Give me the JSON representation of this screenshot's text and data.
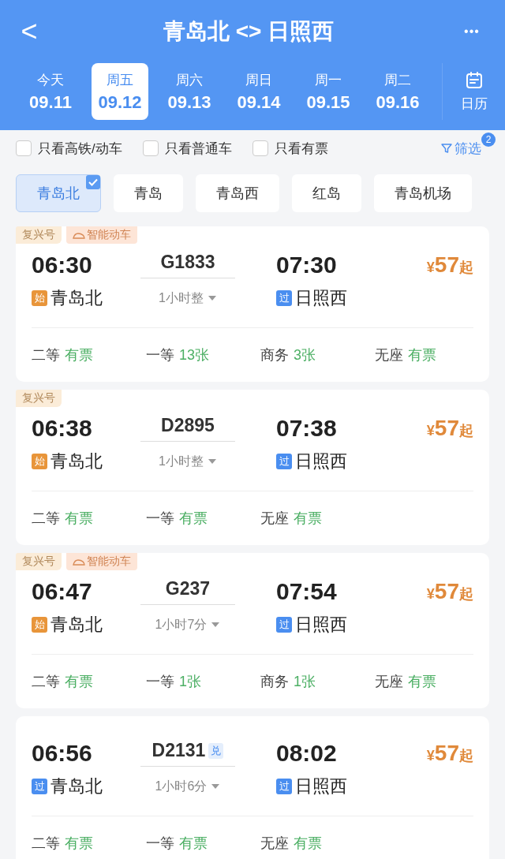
{
  "header": {
    "back": "<",
    "title": "青岛北 <> 日照西",
    "more": "•••"
  },
  "dates": [
    {
      "weekday": "今天",
      "date": "09.11",
      "selected": false
    },
    {
      "weekday": "周五",
      "date": "09.12",
      "selected": true
    },
    {
      "weekday": "周六",
      "date": "09.13",
      "selected": false
    },
    {
      "weekday": "周日",
      "date": "09.14",
      "selected": false
    },
    {
      "weekday": "周一",
      "date": "09.15",
      "selected": false
    },
    {
      "weekday": "周二",
      "date": "09.16",
      "selected": false
    }
  ],
  "calendar": {
    "label": "日历"
  },
  "filters": [
    {
      "label": "只看高铁/动车",
      "checked": false
    },
    {
      "label": "只看普通车",
      "checked": false
    },
    {
      "label": "只看有票",
      "checked": false
    }
  ],
  "filter_button": {
    "label": "筛选",
    "badge": "2"
  },
  "stations": [
    {
      "name": "青岛北",
      "selected": true
    },
    {
      "name": "青岛",
      "selected": false
    },
    {
      "name": "青岛西",
      "selected": false
    },
    {
      "name": "红岛",
      "selected": false
    },
    {
      "name": "青岛机场",
      "selected": false
    }
  ],
  "trains": [
    {
      "tags": [
        {
          "kind": "plain",
          "text": "复兴号"
        },
        {
          "kind": "smart",
          "text": "智能动车"
        }
      ],
      "depart": "06:30",
      "number": "G1833",
      "duration": "1小时整",
      "arrive": "07:30",
      "from": {
        "kind": "start",
        "mark": "始",
        "name": "青岛北"
      },
      "to": {
        "kind": "pass",
        "mark": "过",
        "name": "日照西"
      },
      "currency": "¥",
      "price": "57",
      "suffix": "起",
      "seats": [
        {
          "class": "二等",
          "avail": "有票"
        },
        {
          "class": "一等",
          "avail": "13张"
        },
        {
          "class": "商务",
          "avail": "3张"
        },
        {
          "class": "无座",
          "avail": "有票"
        }
      ]
    },
    {
      "tags": [
        {
          "kind": "plain",
          "text": "复兴号"
        }
      ],
      "depart": "06:38",
      "number": "D2895",
      "duration": "1小时整",
      "arrive": "07:38",
      "from": {
        "kind": "start",
        "mark": "始",
        "name": "青岛北"
      },
      "to": {
        "kind": "pass",
        "mark": "过",
        "name": "日照西"
      },
      "currency": "¥",
      "price": "57",
      "suffix": "起",
      "seats": [
        {
          "class": "二等",
          "avail": "有票"
        },
        {
          "class": "一等",
          "avail": "有票"
        },
        {
          "class": "无座",
          "avail": "有票"
        }
      ]
    },
    {
      "tags": [
        {
          "kind": "plain",
          "text": "复兴号"
        },
        {
          "kind": "smart",
          "text": "智能动车"
        }
      ],
      "depart": "06:47",
      "number": "G237",
      "duration": "1小时7分",
      "arrive": "07:54",
      "from": {
        "kind": "start",
        "mark": "始",
        "name": "青岛北"
      },
      "to": {
        "kind": "pass",
        "mark": "过",
        "name": "日照西"
      },
      "currency": "¥",
      "price": "57",
      "suffix": "起",
      "seats": [
        {
          "class": "二等",
          "avail": "有票"
        },
        {
          "class": "一等",
          "avail": "1张"
        },
        {
          "class": "商务",
          "avail": "1张"
        },
        {
          "class": "无座",
          "avail": "有票"
        }
      ]
    },
    {
      "depart": "06:56",
      "number": "D2131",
      "extra_tag": "兑",
      "duration": "1小时6分",
      "arrive": "08:02",
      "from": {
        "kind": "pass",
        "mark": "过",
        "name": "青岛北"
      },
      "to": {
        "kind": "pass",
        "mark": "过",
        "name": "日照西"
      },
      "currency": "¥",
      "price": "57",
      "suffix": "起",
      "seats": [
        {
          "class": "二等",
          "avail": "有票"
        },
        {
          "class": "一等",
          "avail": "有票"
        },
        {
          "class": "无座",
          "avail": "有票"
        }
      ]
    }
  ]
}
